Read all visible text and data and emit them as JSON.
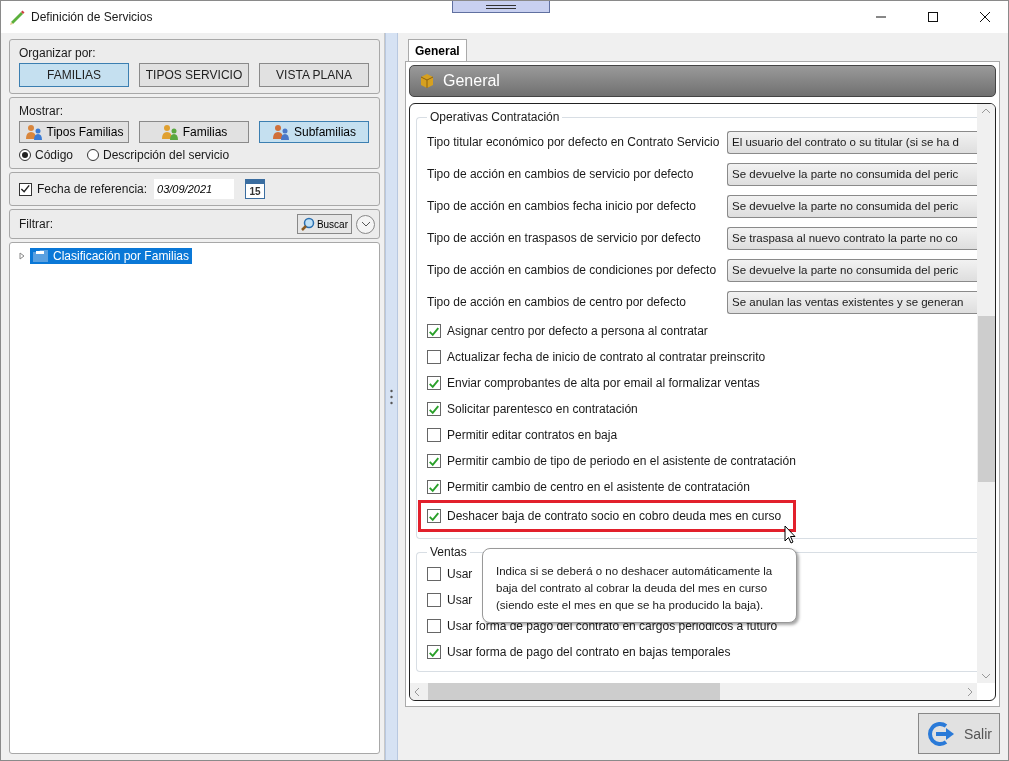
{
  "window": {
    "title": "Definición de Servicios"
  },
  "organize": {
    "label": "Organizar por:",
    "buttons": [
      {
        "label": "FAMILIAS",
        "selected": true
      },
      {
        "label": "TIPOS SERVICIO",
        "selected": false
      },
      {
        "label": "VISTA PLANA",
        "selected": false
      }
    ]
  },
  "show": {
    "label": "Mostrar:",
    "buttons": [
      {
        "label": "Tipos Familias",
        "selected": false
      },
      {
        "label": "Familias",
        "selected": false
      },
      {
        "label": "Subfamilias",
        "selected": true
      }
    ],
    "radios": [
      {
        "label": "Código",
        "selected": true
      },
      {
        "label": "Descripción del servicio",
        "selected": false
      }
    ]
  },
  "reference_date": {
    "label": "Fecha de referencia:",
    "checked": true,
    "value": "03/09/2021",
    "calendar_day": "15"
  },
  "filter": {
    "label": "Filtrar:",
    "search_button": "Buscar"
  },
  "tree": [
    {
      "label": "Clasificación por Familias",
      "selected": true,
      "expanded": false
    }
  ],
  "tabs": [
    {
      "label": "General",
      "selected": true
    }
  ],
  "header": {
    "title": "General"
  },
  "sections": [
    {
      "title": "Operativas Contratación",
      "rows": [
        {
          "kind": "combo",
          "label": "Tipo titular económico por defecto en Contrato Servicio",
          "value": "El usuario del contrato o su titular (si se ha d"
        },
        {
          "kind": "combo",
          "label": "Tipo de acción en cambios de servicio por defecto",
          "value": "Se devuelve la parte no consumida del peric"
        },
        {
          "kind": "combo",
          "label": "Tipo de acción en cambios fecha inicio por defecto",
          "value": "Se devuelve la parte no consumida del peric"
        },
        {
          "kind": "combo",
          "label": "Tipo de acción en traspasos de servicio por defecto",
          "value": "Se traspasa al nuevo contrato la parte no co"
        },
        {
          "kind": "combo",
          "label": "Tipo de acción en cambios de condiciones por defecto",
          "value": "Se devuelve la parte no consumida del peric"
        },
        {
          "kind": "combo",
          "label": "Tipo de acción en cambios de centro por defecto",
          "value": "Se anulan las ventas existentes y se generan"
        },
        {
          "kind": "checkbox",
          "label": "Asignar centro por defecto a persona al contratar",
          "checked": true,
          "highlighted": false
        },
        {
          "kind": "checkbox",
          "label": "Actualizar fecha de inicio de contrato al contratar preinscrito",
          "checked": false,
          "highlighted": false
        },
        {
          "kind": "checkbox",
          "label": "Enviar comprobantes de alta por email al formalizar ventas",
          "checked": true,
          "highlighted": false
        },
        {
          "kind": "checkbox",
          "label": "Solicitar parentesco en contratación",
          "checked": true,
          "highlighted": false
        },
        {
          "kind": "checkbox",
          "label": "Permitir editar contratos en baja",
          "checked": false,
          "highlighted": false
        },
        {
          "kind": "checkbox",
          "label": "Permitir cambio de tipo de periodo en el asistente de contratación",
          "checked": true,
          "highlighted": false
        },
        {
          "kind": "checkbox",
          "label": "Permitir cambio de centro en el asistente de contratación",
          "checked": true,
          "highlighted": false
        },
        {
          "kind": "checkbox",
          "label": "Deshacer baja de contrato socio en cobro deuda mes en curso",
          "checked": true,
          "highlighted": true
        }
      ]
    },
    {
      "title": "Ventas",
      "rows": [
        {
          "kind": "checkbox",
          "label": "Usar",
          "checked": false,
          "highlighted": false
        },
        {
          "kind": "checkbox",
          "label": "Usar",
          "checked": false,
          "highlighted": false
        },
        {
          "kind": "checkbox",
          "label": "Usar forma de pago del contrato en cargos periódicos a futuro",
          "checked": false,
          "highlighted": false
        },
        {
          "kind": "checkbox",
          "label": "Usar forma de pago del contrato en bajas temporales",
          "checked": true,
          "highlighted": false
        }
      ]
    }
  ],
  "tooltip": {
    "text": "Indica si se deberá o no deshacer automáticamente la\nbaja del contrato al cobrar la deuda del mes en curso\n(siendo este el mes en que se ha producido la baja)."
  },
  "buttons": [
    {
      "label": "Salir"
    }
  ]
}
